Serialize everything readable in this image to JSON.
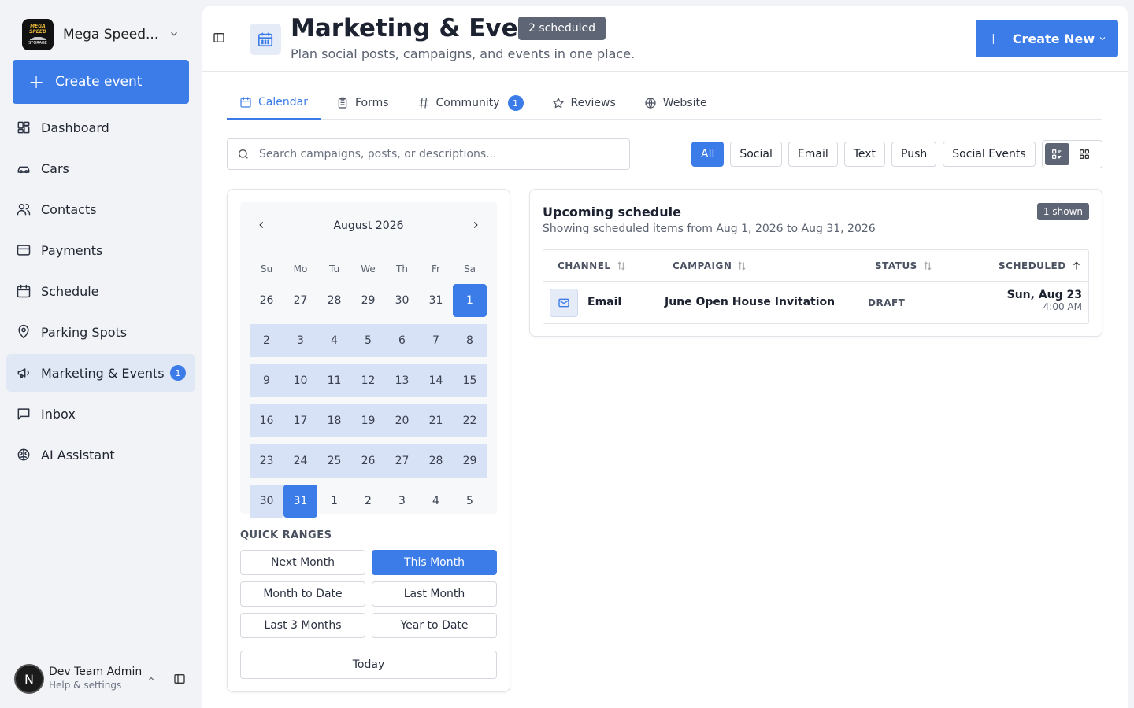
{
  "sidebar": {
    "brand_name": "Mega Speed...",
    "logo_top": "MEGA SPEED",
    "logo_bottom": "STORAGE",
    "create_event": "Create event",
    "items": [
      {
        "label": "Dashboard",
        "icon": "dashboard-icon"
      },
      {
        "label": "Cars",
        "icon": "car-icon"
      },
      {
        "label": "Contacts",
        "icon": "contacts-icon"
      },
      {
        "label": "Payments",
        "icon": "card-icon"
      },
      {
        "label": "Schedule",
        "icon": "calendar-icon"
      },
      {
        "label": "Parking Spots",
        "icon": "map-pin-icon"
      },
      {
        "label": "Marketing & Events",
        "icon": "megaphone-icon",
        "badge": "1",
        "active": true
      },
      {
        "label": "Inbox",
        "icon": "message-icon"
      },
      {
        "label": "AI Assistant",
        "icon": "brain-icon"
      }
    ],
    "user": {
      "initial": "N",
      "name": "Dev Team Admin",
      "sub": "Help & settings"
    }
  },
  "header": {
    "title": "Marketing & Events",
    "badge": "2 scheduled",
    "subtitle": "Plan social posts, campaigns, and events in one place.",
    "create_new": "Create New"
  },
  "tabs": [
    {
      "label": "Calendar",
      "icon": "calendar-icon",
      "active": true
    },
    {
      "label": "Forms",
      "icon": "clipboard-icon"
    },
    {
      "label": "Community",
      "icon": "hash-icon",
      "badge": "1"
    },
    {
      "label": "Reviews",
      "icon": "star-icon"
    },
    {
      "label": "Website",
      "icon": "globe-icon"
    }
  ],
  "search": {
    "placeholder": "Search campaigns, posts, or descriptions..."
  },
  "filters": [
    "All",
    "Social",
    "Email",
    "Text",
    "Push",
    "Social Events"
  ],
  "active_filter": "All",
  "calendar": {
    "month_label": "August 2026",
    "dows": [
      "Su",
      "Mo",
      "Tu",
      "We",
      "Th",
      "Fr",
      "Sa"
    ],
    "weeks": [
      [
        "26",
        "27",
        "28",
        "29",
        "30",
        "31",
        "1"
      ],
      [
        "2",
        "3",
        "4",
        "5",
        "6",
        "7",
        "8"
      ],
      [
        "9",
        "10",
        "11",
        "12",
        "13",
        "14",
        "15"
      ],
      [
        "16",
        "17",
        "18",
        "19",
        "20",
        "21",
        "22"
      ],
      [
        "23",
        "24",
        "25",
        "26",
        "27",
        "28",
        "29"
      ],
      [
        "30",
        "31",
        "1",
        "2",
        "3",
        "4",
        "5"
      ]
    ],
    "range_start": "1",
    "range_end": "31"
  },
  "quick_ranges": {
    "label": "QUICK RANGES",
    "options": [
      "Next Month",
      "This Month",
      "Month to Date",
      "Last Month",
      "Last 3 Months",
      "Year to Date"
    ],
    "active": "This Month",
    "today": "Today"
  },
  "schedule": {
    "title": "Upcoming schedule",
    "subtitle": "Showing scheduled items from Aug 1, 2026 to Aug 31, 2026",
    "shown_badge": "1 shown",
    "columns": [
      "CHANNEL",
      "CAMPAIGN",
      "STATUS",
      "SCHEDULED"
    ],
    "rows": [
      {
        "channel": "Email",
        "campaign": "June Open House Invitation",
        "status": "DRAFT",
        "date": "Sun, Aug 23",
        "time": "4:00 AM"
      }
    ]
  },
  "colors": {
    "accent": "#3b7ce9",
    "badge_gray": "#5e6675",
    "range": "#d8e2f6"
  }
}
